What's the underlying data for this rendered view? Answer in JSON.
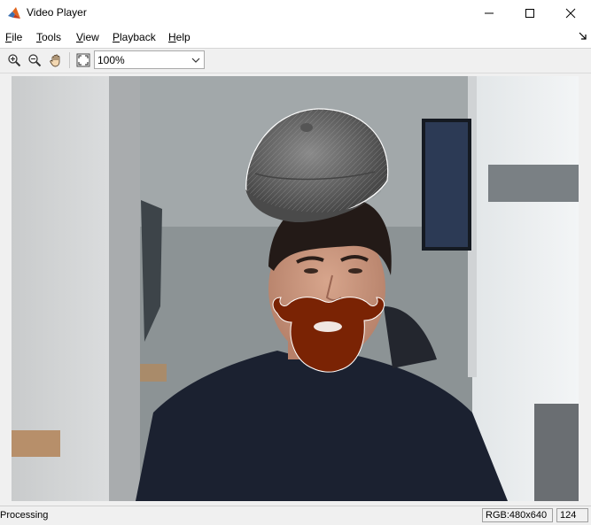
{
  "window": {
    "title": "Video Player",
    "icons": {
      "app": "matlab-logo-icon",
      "minimize": "minimize-icon",
      "maximize": "maximize-icon",
      "close": "close-icon"
    }
  },
  "menu": {
    "file": {
      "mnemonic": "F",
      "rest": "ile"
    },
    "tools": {
      "mnemonic": "T",
      "rest": "ools"
    },
    "view": {
      "mnemonic": "V",
      "rest": "iew"
    },
    "playback": {
      "mnemonic": "P",
      "rest": "layback"
    },
    "help": {
      "mnemonic": "H",
      "rest": "elp"
    }
  },
  "toolbar": {
    "icons": [
      "zoom-in-icon",
      "zoom-out-icon",
      "pan-hand-icon",
      "fit-to-window-icon"
    ],
    "zoom": {
      "value": "100%"
    }
  },
  "video": {
    "description_icons": [
      "flat-cap-overlay",
      "beard-overlay"
    ]
  },
  "status": {
    "text": "Processing",
    "format": "RGB:480x640",
    "frame": "124"
  }
}
